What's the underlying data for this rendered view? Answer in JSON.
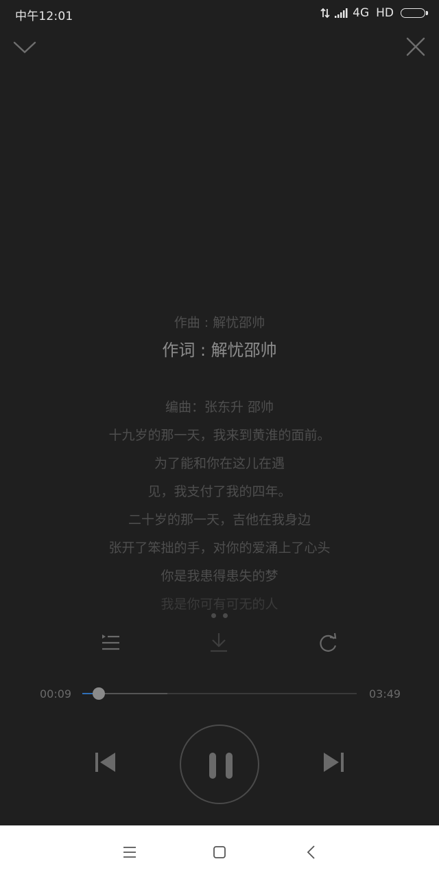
{
  "status_bar": {
    "time": "中午12:01",
    "network": "4G",
    "hd": "HD"
  },
  "icons": {
    "collapse": "chevron-down-icon",
    "close": "close-icon",
    "playlist": "playlist-icon",
    "download": "download-icon",
    "repeat": "repeat-icon",
    "previous": "skip-previous-icon",
    "pause": "pause-icon",
    "next": "skip-next-icon"
  },
  "lyrics": {
    "lines": [
      "作曲 : 解忧邵帅",
      "作词 : 解忧邵帅",
      "编曲：张东升 邵帅",
      "十九岁的那一天，我来到黄淮的面前。",
      "为了能和你在这儿在遇",
      "见，我支付了我的四年。",
      "二十岁的那一天，吉他在我身边",
      "张开了笨拙的手，对你的爱涌上了心头",
      "你是我患得患失的梦",
      "我是你可有可无的人"
    ],
    "current_index": 1
  },
  "pager": {
    "count": 2,
    "active": 1
  },
  "progress": {
    "current": "00:09",
    "total": "03:49",
    "played_fraction": 0.06,
    "buffered_fraction": 0.31
  },
  "colors": {
    "background": "#1f1f1f",
    "accent": "#2f6fb8",
    "lyric_current": "#8c8c8c",
    "lyric_other": "#4e4e4e",
    "navbar": "#ffffff"
  },
  "nav": {
    "menu": "menu-icon",
    "home": "home-icon",
    "back": "back-icon"
  }
}
